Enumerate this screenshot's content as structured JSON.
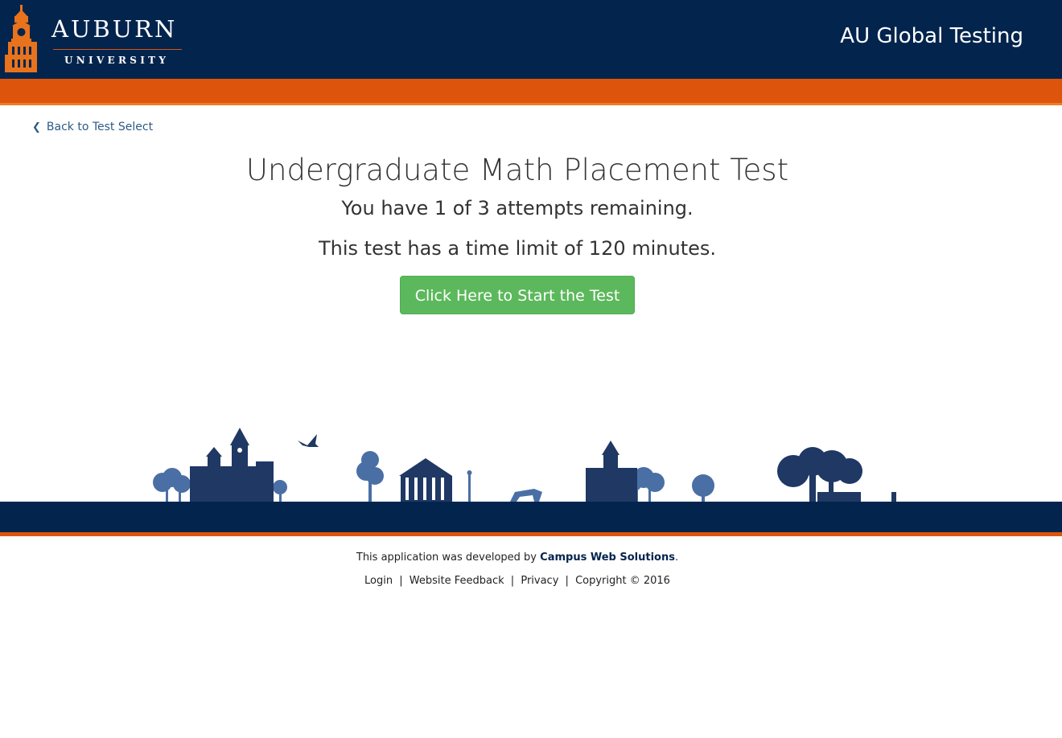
{
  "header": {
    "logo": {
      "wordmark": "AUBURN",
      "subtext": "UNIVERSITY",
      "icon": "samford-hall-tower-icon"
    },
    "site_title": "AU Global Testing"
  },
  "nav": {
    "back_label": "Back to Test Select",
    "back_icon": "chevron-left-icon"
  },
  "main": {
    "test_title": "Undergraduate Math Placement Test",
    "attempts_text": "You have 1 of 3 attempts remaining.",
    "time_limit_text": "This test has a time limit of 120 minutes.",
    "start_button": "Click Here to Start the Test"
  },
  "footer": {
    "developed_by_prefix": "This application was developed by",
    "developer_name": "Campus Web Solutions",
    "developed_by_suffix": ".",
    "links": [
      "Login",
      "Website Feedback",
      "Privacy",
      "Copyright © 2016"
    ],
    "separator": "|"
  },
  "colors": {
    "navy": "#03244d",
    "orange": "#dd550c",
    "button_green": "#5cb85c",
    "link_blue": "#2c5a87",
    "skyline_light": "#4a6fa5"
  }
}
